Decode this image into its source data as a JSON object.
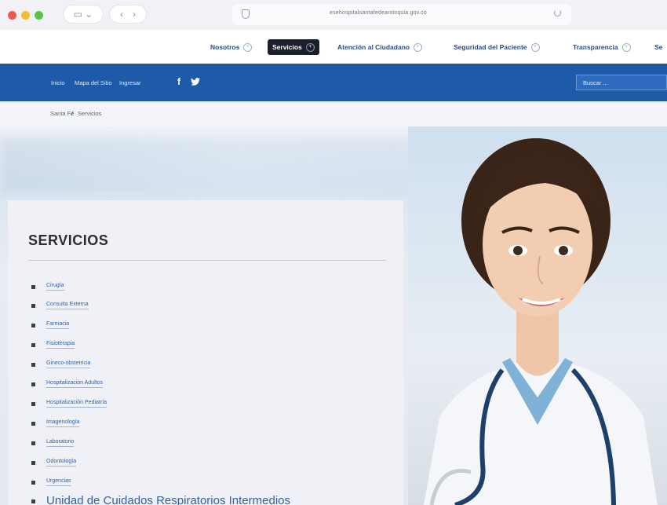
{
  "browser": {
    "url": "esehospitalsantafedeantioquia.gov.co"
  },
  "topnav": {
    "items": [
      {
        "label": "Nosotros"
      },
      {
        "label": "Servicios"
      },
      {
        "label": "Atención al Ciudadano"
      },
      {
        "label": "Seguridad del Paciente"
      },
      {
        "label": "Transparencia"
      },
      {
        "label": "Se"
      }
    ],
    "active": "Servicios"
  },
  "utility": {
    "links": [
      "Inicio",
      "Mapa del Sitio",
      "Ingresar"
    ],
    "social": [
      "f",
      "🐦"
    ],
    "search_placeholder": "Buscar ..."
  },
  "breadcrumb": {
    "home": "Santa Fé",
    "separator": "/",
    "current": "Servicios"
  },
  "services": {
    "title": "SERVICIOS",
    "items": [
      "Cirugía",
      "Consulta Externa",
      "Farmacia",
      "Fisioterapia",
      "Gineco-obstetricia",
      "Hospitalización Adultos",
      "Hospitalización Pediatría",
      "Imagenología",
      "Laboratorio",
      "Odontología",
      "Urgencias",
      "Unidad de Cuidados Respiratorios Intermedios"
    ]
  },
  "colors": {
    "brand_blue": "#1e5aa8",
    "nav_text": "#2a4d85",
    "active_bg": "#1a1f2b",
    "link": "#2f62a8"
  }
}
